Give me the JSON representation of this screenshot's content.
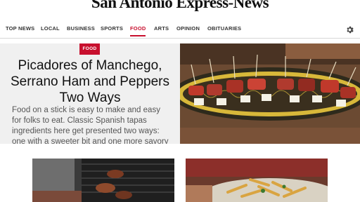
{
  "masthead": {
    "logo_text": "San Antonio Express-News"
  },
  "nav": {
    "items": [
      {
        "label": "TOP NEWS"
      },
      {
        "label": "LOCAL"
      },
      {
        "label": "BUSINESS"
      },
      {
        "label": "SPORTS"
      },
      {
        "label": "FOOD",
        "active": true
      },
      {
        "label": "ARTS"
      },
      {
        "label": "OPINION"
      },
      {
        "label": "OBITUARIES"
      }
    ],
    "settings_icon": "gear-icon"
  },
  "hero": {
    "badge": "FOOD",
    "headline": "Picadores of Manchego, Serrano Ham and Peppers Two Ways",
    "dek": "Food on a stick is easy to make and easy for folks to eat. Classic Spanish tapas ingredients here get presented two ways: one with a sweeter bit and one more savory and"
  },
  "colors": {
    "accent": "#c8102e",
    "hero_bg": "#f0f0f0"
  }
}
